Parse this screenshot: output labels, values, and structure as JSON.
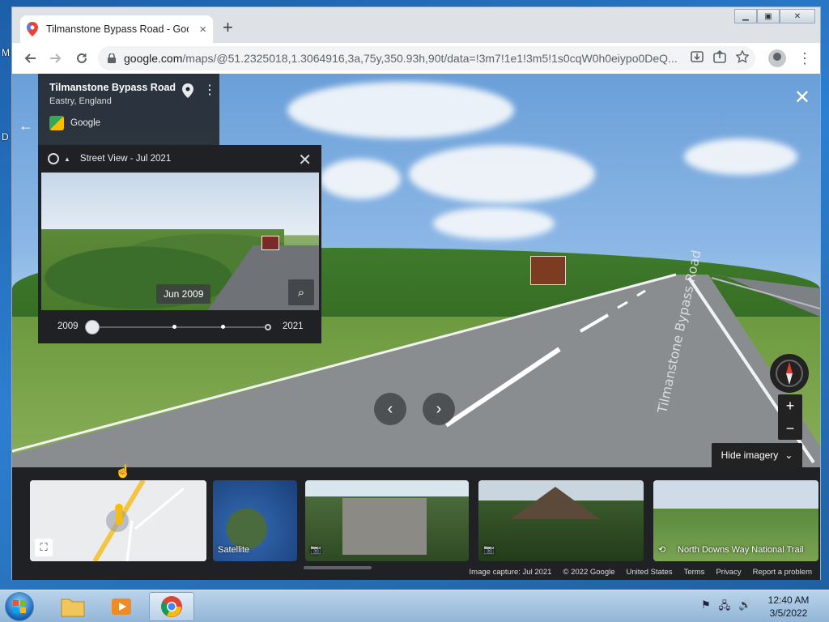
{
  "desktop": {
    "left_letters": [
      "M",
      "D"
    ]
  },
  "browser": {
    "tab_title": "Tilmanstone Bypass Road - Goog",
    "tab_close": "×",
    "new_tab": "+",
    "url_domain": "google.com",
    "url_rest": "/maps/@51.2325018,1.3064916,3a,75y,350.93h,90t/data=!3m7!1e1!3m5!1s0cqW0h0eiypo0DeQ...",
    "window_controls": {
      "minimize": "▁",
      "maximize": "▣",
      "close": "✕"
    }
  },
  "streetview": {
    "place_name": "Tilmanstone Bypass Road",
    "place_sub": "Eastry, England",
    "provider": "Google",
    "time_machine": {
      "title": "Street View - Jul 2021",
      "date_label": "Jun 2009",
      "year_start": "2009",
      "year_end": "2021"
    },
    "hide_imagery": "Hide imagery",
    "zoom_in": "+",
    "zoom_out": "−"
  },
  "thumbnails": [
    {
      "label": ""
    },
    {
      "label": "Satellite"
    },
    {
      "label": ""
    },
    {
      "label": ""
    },
    {
      "label": "North Downs Way National Trail"
    }
  ],
  "footer": {
    "image_capture": "Image capture: Jul 2021",
    "copyright": "© 2022 Google",
    "country": "United States",
    "terms": "Terms",
    "privacy": "Privacy",
    "report": "Report a problem"
  },
  "taskbar": {
    "time": "12:40 AM",
    "date": "3/5/2022"
  }
}
